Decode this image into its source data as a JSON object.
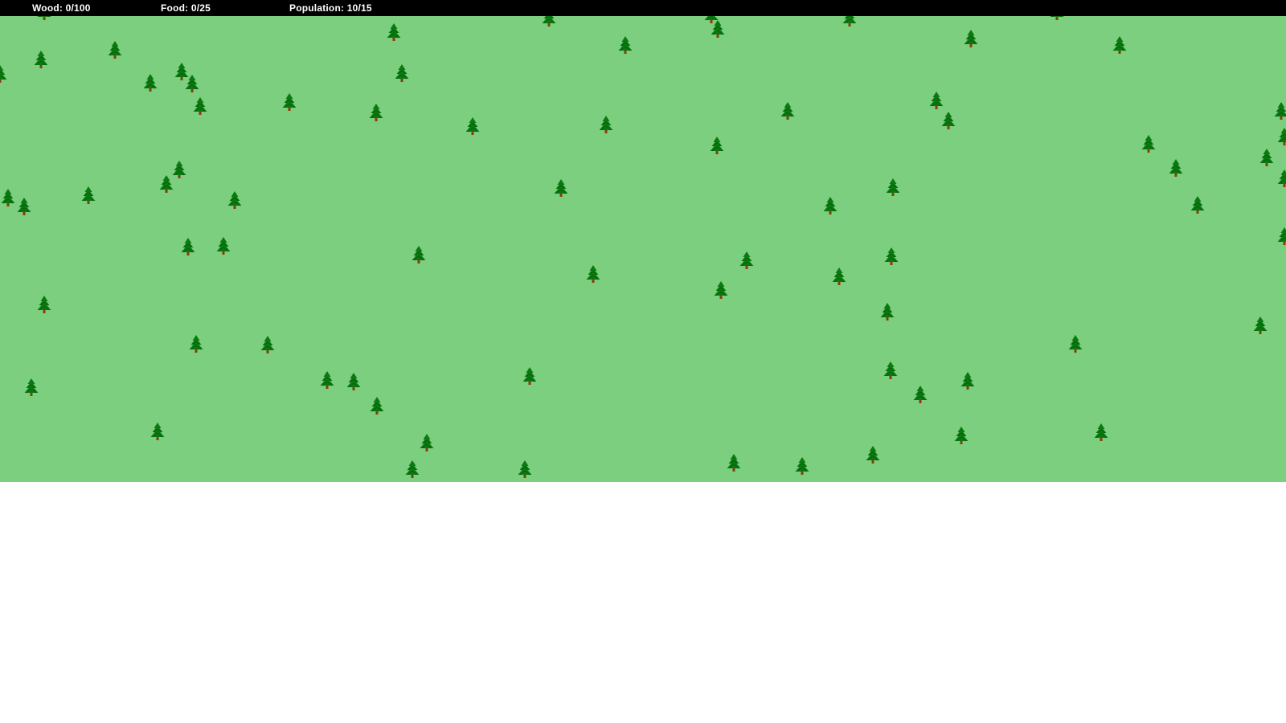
{
  "hud": {
    "wood": "Wood: 0/100",
    "food": "Food: 0/25",
    "population": "Population: 10/15"
  },
  "colors": {
    "hud_background": "#000000",
    "hud_text": "#ffffff",
    "grass": "#7ccf7f",
    "tree_foliage": "#0a7a10",
    "tree_foliage_dark": "#065a0a",
    "tree_trunk": "#8b3a0e",
    "page_background": "#ffffff"
  },
  "world": {
    "tree_icon": "pine-tree-icon"
  }
}
